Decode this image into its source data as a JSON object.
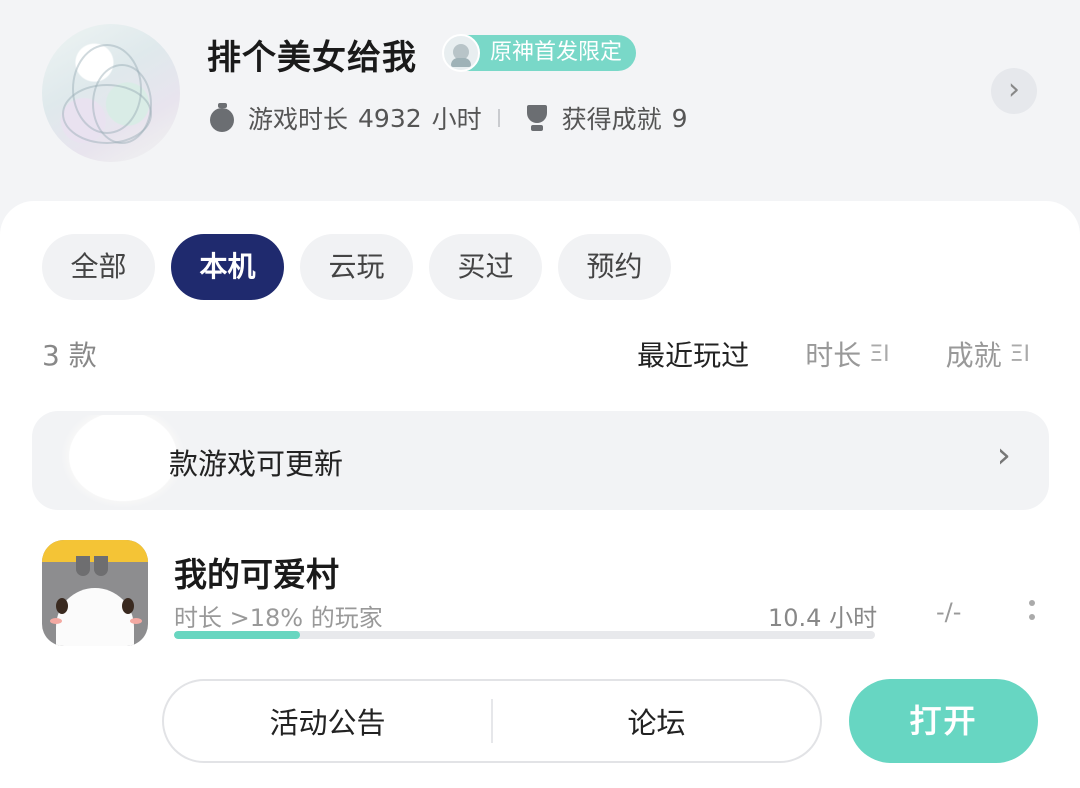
{
  "profile": {
    "username": "排个美女给我",
    "badge_label": "原神首发限定",
    "playtime_label": "游戏时长",
    "playtime_value": "4932",
    "playtime_unit": "小时",
    "achievements_label": "获得成就",
    "achievements_value": "9",
    "arrow_icon": "chevron-right-icon"
  },
  "tabs": [
    {
      "label": "全部",
      "active": false
    },
    {
      "label": "本机",
      "active": true
    },
    {
      "label": "云玩",
      "active": false
    },
    {
      "label": "买过",
      "active": false
    },
    {
      "label": "预约",
      "active": false
    }
  ],
  "list": {
    "count": "3 款",
    "sorts": [
      {
        "label": "最近玩过",
        "active": true
      },
      {
        "label": "时长",
        "icon": "ΞI",
        "active": false
      },
      {
        "label": "成就",
        "icon": "ΞI",
        "active": false
      }
    ]
  },
  "update_bar": {
    "text": "款游戏可更新"
  },
  "game": {
    "name": "我的可爱村",
    "subtitle": "时长 >18% 的玩家",
    "hours": "10.4 小时",
    "achievements": "-/-",
    "progress": 0.18
  },
  "actions": {
    "announcement": "活动公告",
    "forum": "论坛",
    "open": "打开"
  },
  "colors": {
    "accent": "#67d6c2",
    "tab_active": "#1f2a6e",
    "badge": "#79d8c8"
  }
}
